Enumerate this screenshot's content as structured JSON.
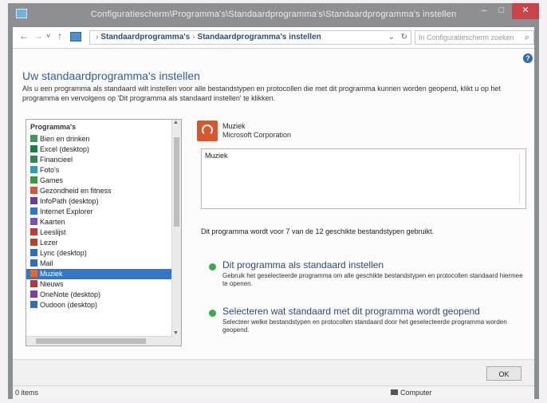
{
  "window": {
    "title": "Configuratiescherm\\Programma's\\Standaardprogramma's\\Standaardprogramma's instellen",
    "min_glyph": "–",
    "max_glyph": "□",
    "close_glyph": "✕"
  },
  "nav": {
    "back_glyph": "←",
    "forward_glyph": "→",
    "recent_glyph": "˅",
    "up_glyph": "↑",
    "breadcrumb": [
      "Standaardprogramma's",
      "Standaardprogramma's instellen"
    ],
    "search_placeholder": "In Configuratiescherm zoeken"
  },
  "page": {
    "title": "Uw standaardprogramma's instellen",
    "intro": "Als u een programma als standaard wilt instellen voor alle bestandstypen en protocollen die met dit programma kunnen worden geopend, klikt u op het programma en vervolgens op 'Dit programma als standaard instellen' te klikken."
  },
  "programs": {
    "header": "Programma's",
    "items": [
      {
        "label": "Bien en drinken",
        "color": "#3b9a5b"
      },
      {
        "label": "Excel (desktop)",
        "color": "#1e7d45"
      },
      {
        "label": "Financieel",
        "color": "#2f8a4d"
      },
      {
        "label": "Foto's",
        "color": "#2aa0b8"
      },
      {
        "label": "Games",
        "color": "#3a9a3a"
      },
      {
        "label": "Gezondheid en fitness",
        "color": "#d5573a"
      },
      {
        "label": "InfoPath (desktop)",
        "color": "#6a3d9a"
      },
      {
        "label": "Internet Explorer",
        "color": "#2f78c4"
      },
      {
        "label": "Kaarten",
        "color": "#7a4fb8"
      },
      {
        "label": "Leeslijst",
        "color": "#c2383a"
      },
      {
        "label": "Lezer",
        "color": "#c23e2e"
      },
      {
        "label": "Lync (desktop)",
        "color": "#2f6fb8"
      },
      {
        "label": "Mail",
        "color": "#2f6fb8"
      },
      {
        "label": "Muziek",
        "color": "#e8662a"
      },
      {
        "label": "Nieuws",
        "color": "#b8353a"
      },
      {
        "label": "OneNote (desktop)",
        "color": "#7a3f9e"
      },
      {
        "label": "Oudoon (desktop)",
        "color": "#2f6fb8"
      }
    ],
    "selected_index": 13
  },
  "selected_program": {
    "name": "Muziek",
    "company": "Microsoft Corporation",
    "description": "Muziek",
    "icon": "headphones-icon",
    "usage": "Dit programma wordt voor 7 van de 12 geschikte bestandstypen gebruikt."
  },
  "actions": [
    {
      "title": "Dit programma als standaard instellen",
      "subtitle": "Gebruik het geselecteerde programma om alle geschikte bestandstypen en protocollen standaard hiermee te openen."
    },
    {
      "title": "Selecteren wat standaard met dit programma wordt geopend",
      "subtitle": "Selecteer welke bestandstypen en protocollen standaard door het geselecteerde programma worden geopend."
    }
  ],
  "footer": {
    "ok_label": "OK"
  },
  "status": {
    "count": "0 items",
    "zone": "Computer"
  },
  "colors": {
    "accent": "#2d5f9a",
    "selection": "#3478c4",
    "close": "#c84449",
    "bullet": "#3aa84e"
  }
}
